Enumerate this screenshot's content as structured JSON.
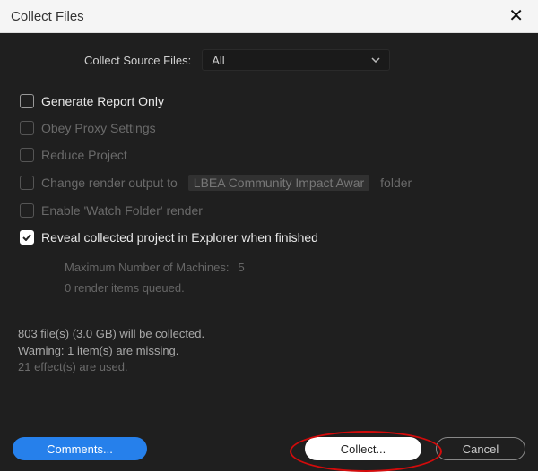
{
  "titlebar": {
    "title": "Collect Files"
  },
  "source": {
    "label": "Collect Source Files:",
    "value": "All"
  },
  "options": {
    "generate_report": "Generate Report Only",
    "obey_proxy": "Obey Proxy Settings",
    "reduce_project": "Reduce Project",
    "change_output_pre": "Change render output to",
    "change_output_chip": "LBEA Community Impact Awar",
    "change_output_post": "folder",
    "watch_folder": "Enable 'Watch Folder' render",
    "reveal": "Reveal collected project in Explorer when finished"
  },
  "machines": {
    "label": "Maximum Number of Machines:",
    "value": "5",
    "queued": "0 render items queued."
  },
  "status": {
    "line1": "803 file(s) (3.0 GB) will be collected.",
    "line2": "Warning: 1 item(s) are missing.",
    "line3": "21 effect(s) are used."
  },
  "buttons": {
    "comments": "Comments...",
    "collect": "Collect...",
    "cancel": "Cancel"
  }
}
